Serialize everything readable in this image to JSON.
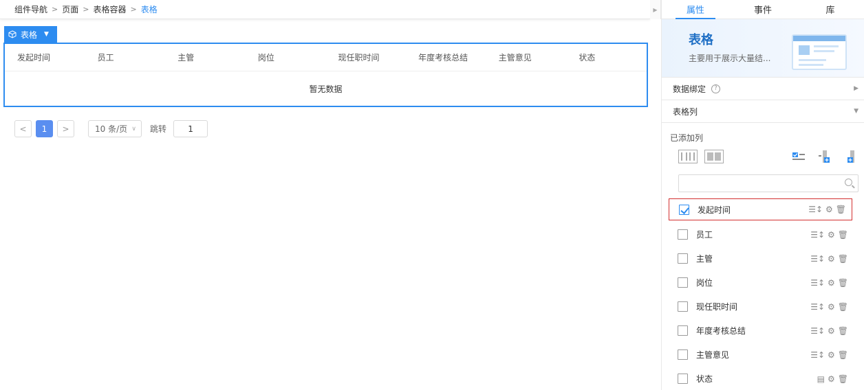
{
  "breadcrumb": [
    "组件导航",
    "页面",
    "表格容器",
    "表格"
  ],
  "widget_tag": "表格",
  "table": {
    "columns": [
      "发起时间",
      "员工",
      "主管",
      "岗位",
      "现任职时间",
      "年度考核总结",
      "主管意见",
      "状态"
    ],
    "empty_text": "暂无数据"
  },
  "pager": {
    "prev": "<",
    "current": "1",
    "next": ">",
    "page_size": "10 条/页",
    "jump_label": "跳转",
    "jump_value": "1"
  },
  "panel": {
    "tabs": [
      "属性",
      "事件",
      "库"
    ],
    "active_tab": "属性",
    "hero_title": "表格",
    "hero_sub": "主要用于展示大量结...",
    "data_binding": "数据绑定",
    "table_columns_section": "表格列",
    "added_columns_label": "已添加列",
    "search_placeholder": "",
    "column_items": [
      {
        "label": "发起时间",
        "checked": true
      },
      {
        "label": "员工",
        "checked": false
      },
      {
        "label": "主管",
        "checked": false
      },
      {
        "label": "岗位",
        "checked": false
      },
      {
        "label": "现任职时间",
        "checked": false
      },
      {
        "label": "年度考核总结",
        "checked": false
      },
      {
        "label": "主管意见",
        "checked": false
      },
      {
        "label": "状态",
        "checked": false
      }
    ]
  },
  "colors": {
    "accent": "#2d8cf0",
    "highlight": "#d32f2f"
  }
}
